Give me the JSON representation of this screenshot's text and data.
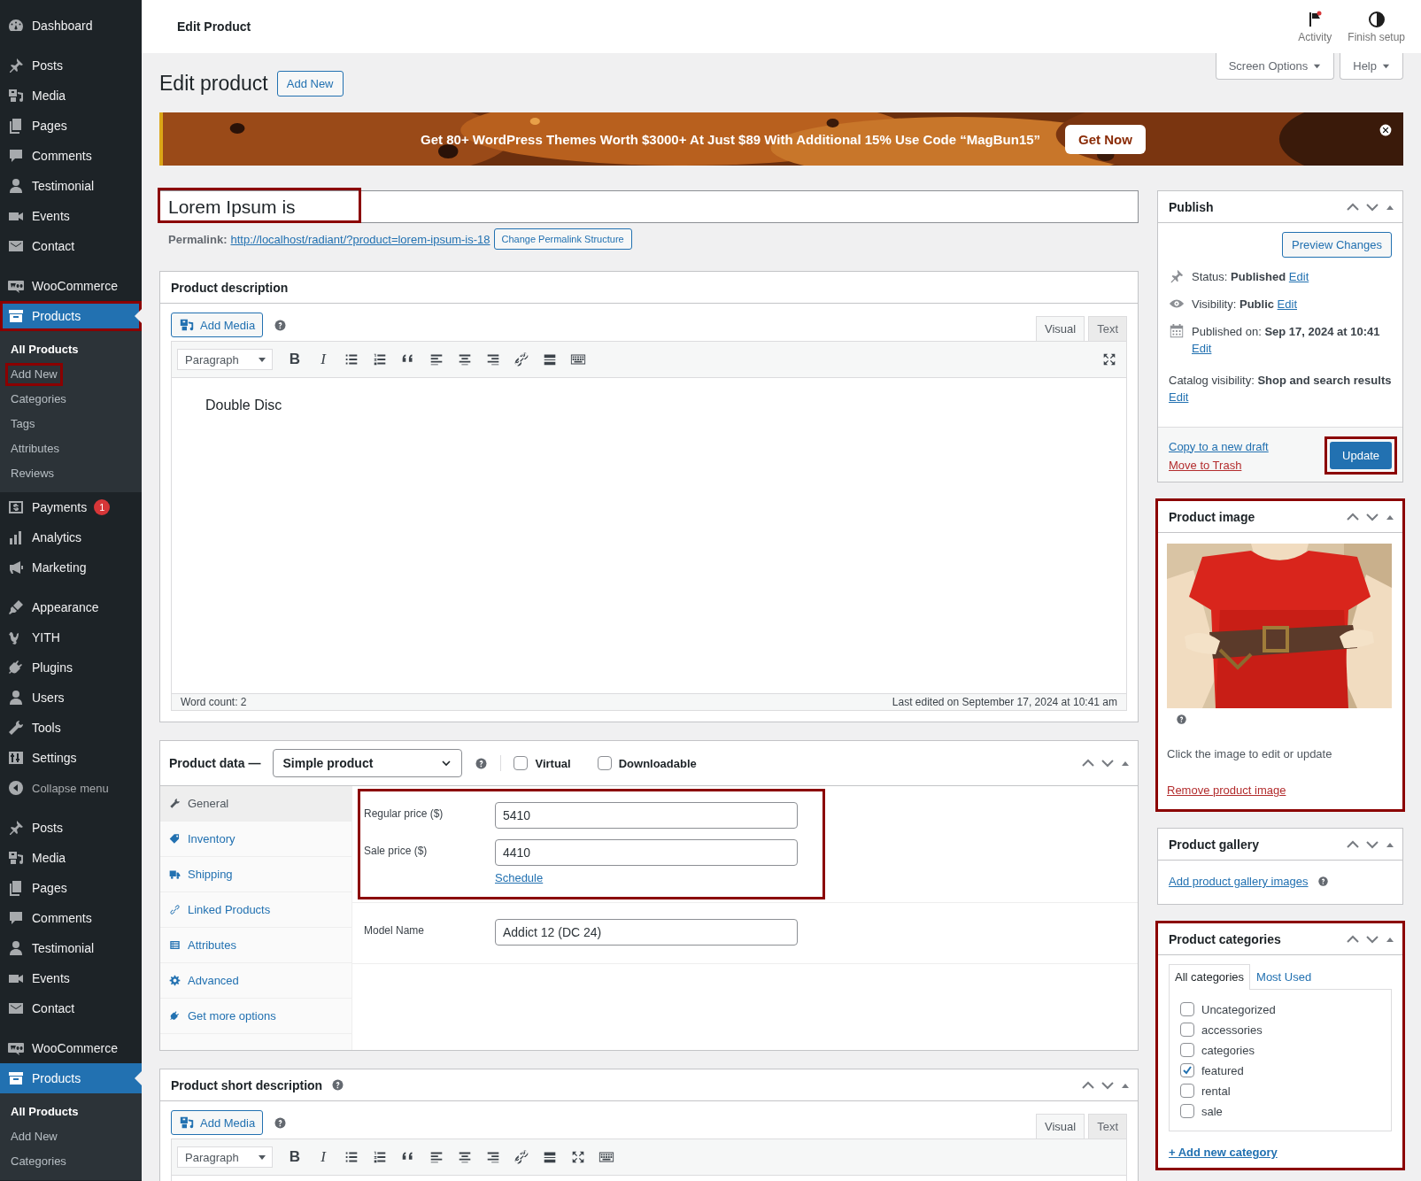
{
  "sidebar": {
    "groups": [
      [
        {
          "label": "Dashboard",
          "kind": "menu",
          "selected": false,
          "highlighted": false
        }
      ],
      [
        {
          "label": "Posts",
          "kind": "menu",
          "selected": false,
          "highlighted": false
        },
        {
          "label": "Media",
          "kind": "menu",
          "selected": false,
          "highlighted": false
        },
        {
          "label": "Pages",
          "kind": "menu",
          "selected": false,
          "highlighted": false
        },
        {
          "label": "Comments",
          "kind": "menu",
          "selected": false,
          "highlighted": false
        },
        {
          "label": "Testimonial",
          "kind": "menu",
          "selected": false,
          "highlighted": false
        },
        {
          "label": "Events",
          "kind": "menu",
          "selected": false,
          "highlighted": false
        },
        {
          "label": "Contact",
          "kind": "menu",
          "selected": false,
          "highlighted": false
        }
      ],
      [
        {
          "label": "WooCommerce",
          "kind": "menu",
          "selected": false,
          "highlighted": false
        },
        {
          "label": "Products",
          "kind": "menu",
          "selected": true,
          "highlighted": true,
          "submenu": [
            {
              "label": "All Products",
              "selected": true,
              "highlighted": false
            },
            {
              "label": "Add New",
              "selected": false,
              "highlighted": true
            },
            {
              "label": "Categories",
              "selected": false,
              "highlighted": false
            },
            {
              "label": "Tags",
              "selected": false,
              "highlighted": false
            },
            {
              "label": "Attributes",
              "selected": false,
              "highlighted": false
            },
            {
              "label": "Reviews",
              "selected": false,
              "highlighted": false
            }
          ]
        },
        {
          "label": "Payments",
          "kind": "menu",
          "badge": "1",
          "selected": false,
          "highlighted": false
        },
        {
          "label": "Analytics",
          "kind": "menu",
          "selected": false,
          "highlighted": false
        },
        {
          "label": "Marketing",
          "kind": "menu",
          "selected": false,
          "highlighted": false
        }
      ],
      [
        {
          "label": "Appearance",
          "kind": "menu",
          "selected": false,
          "highlighted": false
        },
        {
          "label": "YITH",
          "kind": "menu",
          "selected": false,
          "highlighted": false
        },
        {
          "label": "Plugins",
          "kind": "menu",
          "selected": false,
          "highlighted": false
        },
        {
          "label": "Users",
          "kind": "menu",
          "selected": false,
          "highlighted": false
        },
        {
          "label": "Tools",
          "kind": "menu",
          "selected": false,
          "highlighted": false
        },
        {
          "label": "Settings",
          "kind": "menu",
          "selected": false,
          "highlighted": false
        },
        {
          "label": "Collapse menu",
          "kind": "collapse",
          "selected": false,
          "highlighted": false
        }
      ],
      [
        {
          "label": "Posts",
          "kind": "menu",
          "selected": false,
          "highlighted": false
        },
        {
          "label": "Media",
          "kind": "menu",
          "selected": false,
          "highlighted": false
        },
        {
          "label": "Pages",
          "kind": "menu",
          "selected": false,
          "highlighted": false
        },
        {
          "label": "Comments",
          "kind": "menu",
          "selected": false,
          "highlighted": false
        },
        {
          "label": "Testimonial",
          "kind": "menu",
          "selected": false,
          "highlighted": false
        },
        {
          "label": "Events",
          "kind": "menu",
          "selected": false,
          "highlighted": false
        },
        {
          "label": "Contact",
          "kind": "menu",
          "selected": false,
          "highlighted": false
        }
      ],
      [
        {
          "label": "WooCommerce",
          "kind": "menu",
          "selected": false,
          "highlighted": false
        },
        {
          "label": "Products",
          "kind": "menu",
          "selected": true,
          "highlighted": false,
          "submenu": [
            {
              "label": "All Products",
              "selected": true,
              "highlighted": false
            },
            {
              "label": "Add New",
              "selected": false,
              "highlighted": false
            },
            {
              "label": "Categories",
              "selected": false,
              "highlighted": false
            }
          ]
        }
      ]
    ]
  },
  "admin_bar": {
    "title": "Edit Product",
    "actions": [
      {
        "label": "Activity"
      },
      {
        "label": "Finish setup"
      }
    ]
  },
  "screen_tabs": [
    {
      "label": "Screen Options"
    },
    {
      "label": "Help"
    }
  ],
  "heading": {
    "title": "Edit product",
    "button": "Add New"
  },
  "banner": {
    "text": "Get 80+ WordPress Themes Worth $3000+ At Just $89 With Additional 15% Use Code “MagBun15”",
    "button": "Get Now"
  },
  "title_field": {
    "value": "Lorem Ipsum is",
    "highlighted": true
  },
  "permalink": {
    "label": "Permalink:",
    "url": "http://localhost/radiant/?product=lorem-ipsum-is-18",
    "button": "Change Permalink Structure"
  },
  "description": {
    "title": "Product description",
    "add_media": "Add Media",
    "tabs": [
      {
        "label": "Visual",
        "selected": true
      },
      {
        "label": "Text",
        "selected": false
      }
    ],
    "format": "Paragraph",
    "toolbar": [
      {
        "kind": "bold",
        "label": "B"
      },
      {
        "kind": "italic",
        "label": "I"
      },
      {
        "kind": "bullets"
      },
      {
        "kind": "numbers"
      },
      {
        "kind": "quote"
      },
      {
        "kind": "left"
      },
      {
        "kind": "center"
      },
      {
        "kind": "right"
      },
      {
        "kind": "link"
      },
      {
        "kind": "more"
      },
      {
        "kind": "keyboard"
      }
    ],
    "toolbar_end": [
      {
        "kind": "fullscreen"
      }
    ],
    "content": "Double Disc",
    "word_count": "Word count: 2",
    "last_edited": "Last edited on September 17, 2024 at 10:41 am"
  },
  "product_data": {
    "title": "Product data —",
    "type": "Simple product",
    "options": [
      {
        "label": "Virtual",
        "checked": false
      },
      {
        "label": "Downloadable",
        "checked": false
      }
    ],
    "tabs": [
      {
        "label": "General",
        "selected": true
      },
      {
        "label": "Inventory",
        "selected": false
      },
      {
        "label": "Shipping",
        "selected": false
      },
      {
        "label": "Linked Products",
        "selected": false
      },
      {
        "label": "Attributes",
        "selected": false
      },
      {
        "label": "Advanced",
        "selected": false
      },
      {
        "label": "Get more options",
        "selected": false
      }
    ],
    "field_groups": [
      {
        "highlighted": true,
        "fields": [
          {
            "label": "Regular price ($)",
            "value": "5410"
          },
          {
            "label": "Sale price ($)",
            "value": "4410",
            "link": "Schedule"
          }
        ]
      },
      {
        "highlighted": false,
        "fields": [
          {
            "label": "Model Name",
            "value": "Addict 12 (DC 24)"
          }
        ]
      }
    ]
  },
  "short_description": {
    "title": "Product short description",
    "add_media": "Add Media",
    "tabs": [
      {
        "label": "Visual",
        "selected": true
      },
      {
        "label": "Text",
        "selected": false
      }
    ],
    "format": "Paragraph",
    "toolbar": [
      {
        "kind": "bold",
        "label": "B"
      },
      {
        "kind": "italic",
        "label": "I"
      },
      {
        "kind": "bullets"
      },
      {
        "kind": "numbers"
      },
      {
        "kind": "quote"
      },
      {
        "kind": "left"
      },
      {
        "kind": "center"
      },
      {
        "kind": "right"
      },
      {
        "kind": "link"
      },
      {
        "kind": "more"
      },
      {
        "kind": "fullscreen"
      },
      {
        "kind": "keyboard"
      }
    ]
  },
  "publish": {
    "title": "Publish",
    "preview": "Preview Changes",
    "rows": [
      {
        "label": "Status:",
        "value": "Published",
        "edit": "Edit"
      },
      {
        "label": "Visibility:",
        "value": "Public",
        "edit": "Edit"
      },
      {
        "label": "Published on:",
        "value": "Sep 17, 2024 at 10:41",
        "edit": "Edit"
      },
      {
        "label": "Catalog visibility:",
        "value": "Shop and search results",
        "edit": "Edit"
      }
    ],
    "copy": "Copy to a new draft",
    "trash": "Move to Trash",
    "update": {
      "label": "Update",
      "highlighted": true
    }
  },
  "product_image": {
    "title": "Product image",
    "highlighted": true,
    "hint": "Click the image to edit or update",
    "remove": "Remove product image"
  },
  "gallery": {
    "title": "Product gallery",
    "highlighted": false,
    "link": "Add product gallery images"
  },
  "categories": {
    "title": "Product categories",
    "highlighted": true,
    "tabs": [
      {
        "label": "All categories",
        "selected": true
      },
      {
        "label": "Most Used",
        "selected": false
      }
    ],
    "items": [
      {
        "label": "Uncategorized",
        "checked": false
      },
      {
        "label": "accessories",
        "checked": false
      },
      {
        "label": "categories",
        "checked": false
      },
      {
        "label": "featured",
        "checked": true
      },
      {
        "label": "rental",
        "checked": false
      },
      {
        "label": "sale",
        "checked": false
      }
    ],
    "add": "+ Add new category"
  }
}
